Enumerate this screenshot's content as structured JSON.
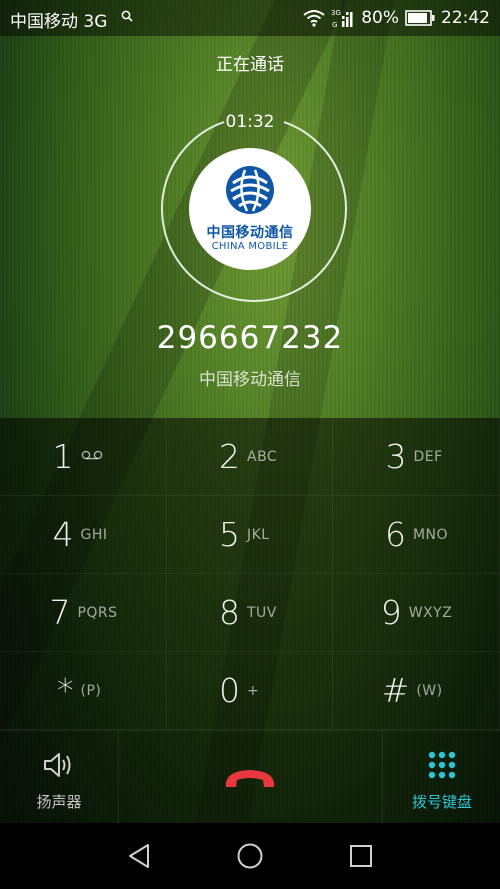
{
  "status_bar": {
    "carrier": "中国移动 3G",
    "network_small_top": "3G",
    "network_small_bottom": "G",
    "battery_percent": "80%",
    "time": "22:42"
  },
  "call": {
    "status": "正在通话",
    "timer": "01:32",
    "number": "296667232",
    "carrier_name": "中国移动通信",
    "logo_cn": "中国移动通信",
    "logo_en": "CHINA MOBILE"
  },
  "dialpad": [
    {
      "digit": "1",
      "letters": ""
    },
    {
      "digit": "2",
      "letters": "ABC"
    },
    {
      "digit": "3",
      "letters": "DEF"
    },
    {
      "digit": "4",
      "letters": "GHI"
    },
    {
      "digit": "5",
      "letters": "JKL"
    },
    {
      "digit": "6",
      "letters": "MNO"
    },
    {
      "digit": "7",
      "letters": "PQRS"
    },
    {
      "digit": "8",
      "letters": "TUV"
    },
    {
      "digit": "9",
      "letters": "WXYZ"
    },
    {
      "digit": "*",
      "letters": "(P)"
    },
    {
      "digit": "0",
      "letters": "+"
    },
    {
      "digit": "#",
      "letters": "(W)"
    }
  ],
  "actions": {
    "speaker_label": "扬声器",
    "keypad_label": "拨号键盘"
  },
  "colors": {
    "accent": "#2fc4d3",
    "end_call": "#e8383d",
    "logo_blue": "#0f57a6"
  }
}
